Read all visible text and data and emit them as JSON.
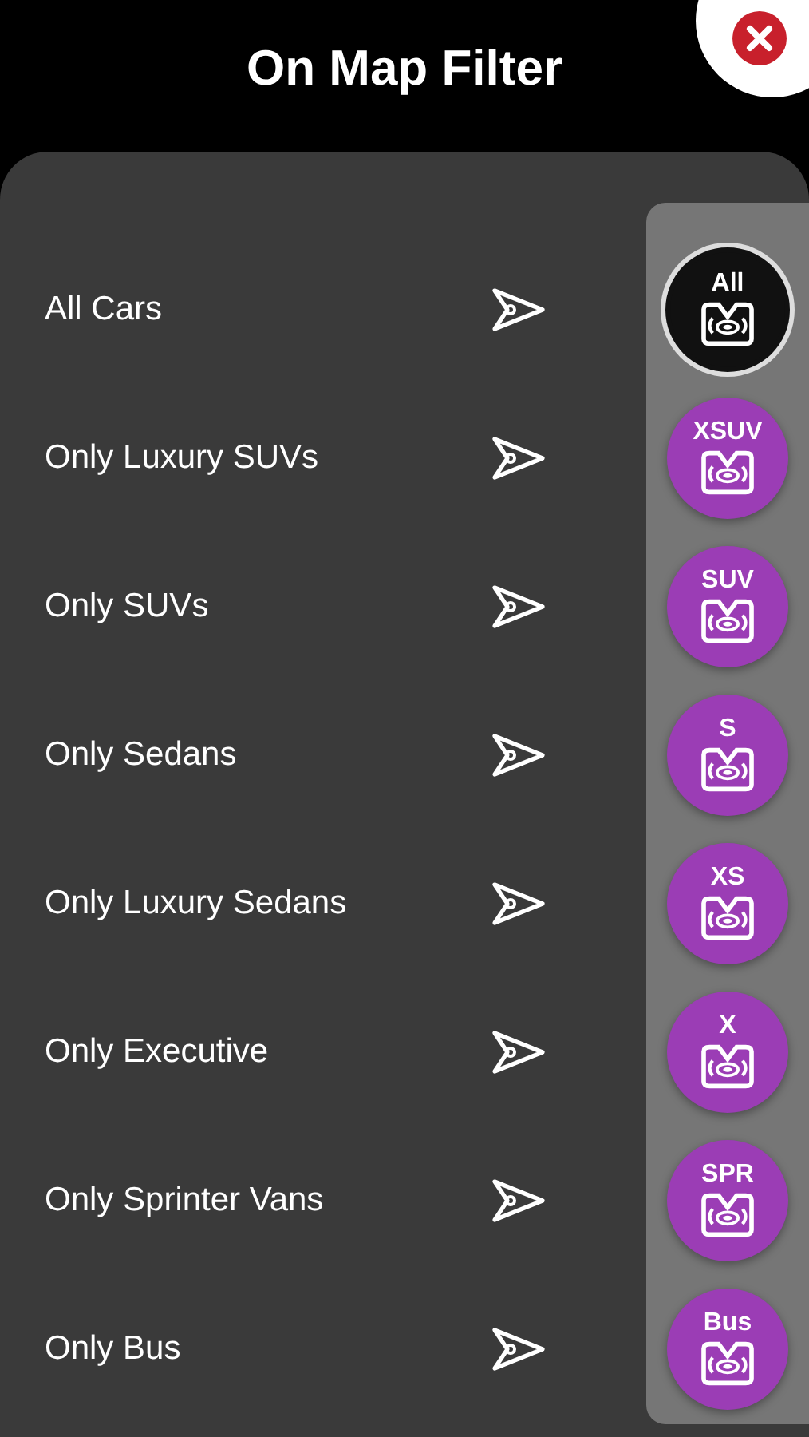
{
  "title": "On Map Filter",
  "filters": [
    {
      "label": "All Cars",
      "badge": "All",
      "selected": true
    },
    {
      "label": "Only Luxury SUVs",
      "badge": "XSUV",
      "selected": false
    },
    {
      "label": "Only SUVs",
      "badge": "SUV",
      "selected": false
    },
    {
      "label": "Only Sedans",
      "badge": "S",
      "selected": false
    },
    {
      "label": "Only Luxury Sedans",
      "badge": "XS",
      "selected": false
    },
    {
      "label": "Only Executive",
      "badge": "X",
      "selected": false
    },
    {
      "label": "Only Sprinter Vans",
      "badge": "SPR",
      "selected": false
    },
    {
      "label": "Only Bus",
      "badge": "Bus",
      "selected": false
    }
  ]
}
